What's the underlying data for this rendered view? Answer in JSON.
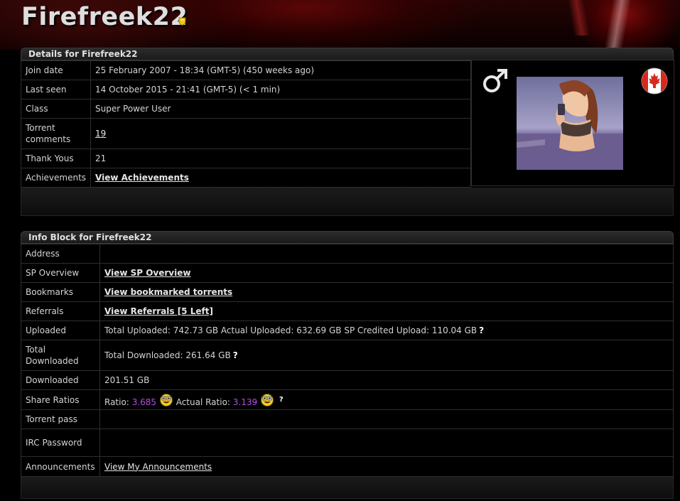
{
  "header": {
    "username": "Firefreek22"
  },
  "details": {
    "title": "Details for Firefreek22",
    "rows": [
      {
        "label": "Join date",
        "value": "25 February 2007 - 18:34 (GMT-5) (450 weeks ago)"
      },
      {
        "label": "Last seen",
        "value": "14 October 2015 - 21:41 (GMT-5) (< 1 min)"
      },
      {
        "label": "Class",
        "value": "Super Power User"
      },
      {
        "label": "Torrent comments",
        "value": "19"
      },
      {
        "label": "Thank Yous",
        "value": "21"
      },
      {
        "label": "Achievements",
        "value": "View Achievements"
      }
    ],
    "gender_icon": "male-symbol-icon",
    "flag_icon": "canada-flag-icon",
    "avatar_icon": "anime-avatar-image"
  },
  "info": {
    "title": "Info Block for Firefreek22",
    "address_label": "Address",
    "sp_label": "SP Overview",
    "sp_link": "View SP Overview",
    "bookmarks_label": "Bookmarks",
    "bookmarks_link": "View bookmarked torrents",
    "referrals_label": "Referrals",
    "referrals_link": "View Referrals [5 Left]",
    "uploaded_label": "Uploaded",
    "uploaded_value": "Total Uploaded: 742.73 GB Actual Uploaded: 632.69 GB SP Credited Upload: 110.04 GB",
    "total_downloaded_label": "Total Downloaded",
    "total_downloaded_value": "Total Downloaded: 261.64 GB",
    "downloaded_label": "Downloaded",
    "downloaded_value": "201.51 GB",
    "share_label": "Share Ratios",
    "ratio_text": "Ratio:",
    "ratio_value": "3.685",
    "actual_ratio_text": "Actual Ratio:",
    "actual_ratio_value": "3.139",
    "ratio_color": "#b54ce6",
    "help_mark": "?",
    "torrent_pass_label": "Torrent pass",
    "irc_label": "IRC Password",
    "announcements_label": "Announcements",
    "announcements_link": "View My Announcements"
  }
}
